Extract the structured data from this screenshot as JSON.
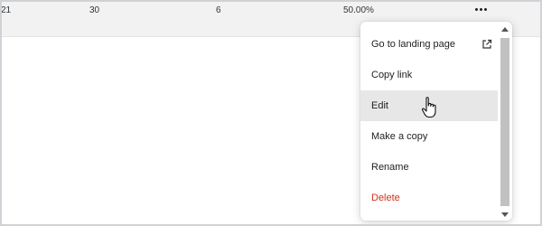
{
  "table_row": {
    "cells": [
      "21",
      "30",
      "6",
      "50.00%"
    ]
  },
  "more_button": {
    "icon": "more-horizontal-icon"
  },
  "context_menu": {
    "items": [
      {
        "label": "Go to landing page",
        "icon": "external-link-icon"
      },
      {
        "label": "Copy link"
      },
      {
        "label": "Edit",
        "state": "hover"
      },
      {
        "label": "Make a copy"
      },
      {
        "label": "Rename"
      },
      {
        "label": "Delete",
        "color": "#d0311c"
      }
    ]
  },
  "colors": {
    "row_background": "#f2f2f2",
    "hover_background": "#e7e7e7",
    "danger": "#d0311c"
  },
  "cursor": {
    "icon": "hand-pointer-icon"
  }
}
